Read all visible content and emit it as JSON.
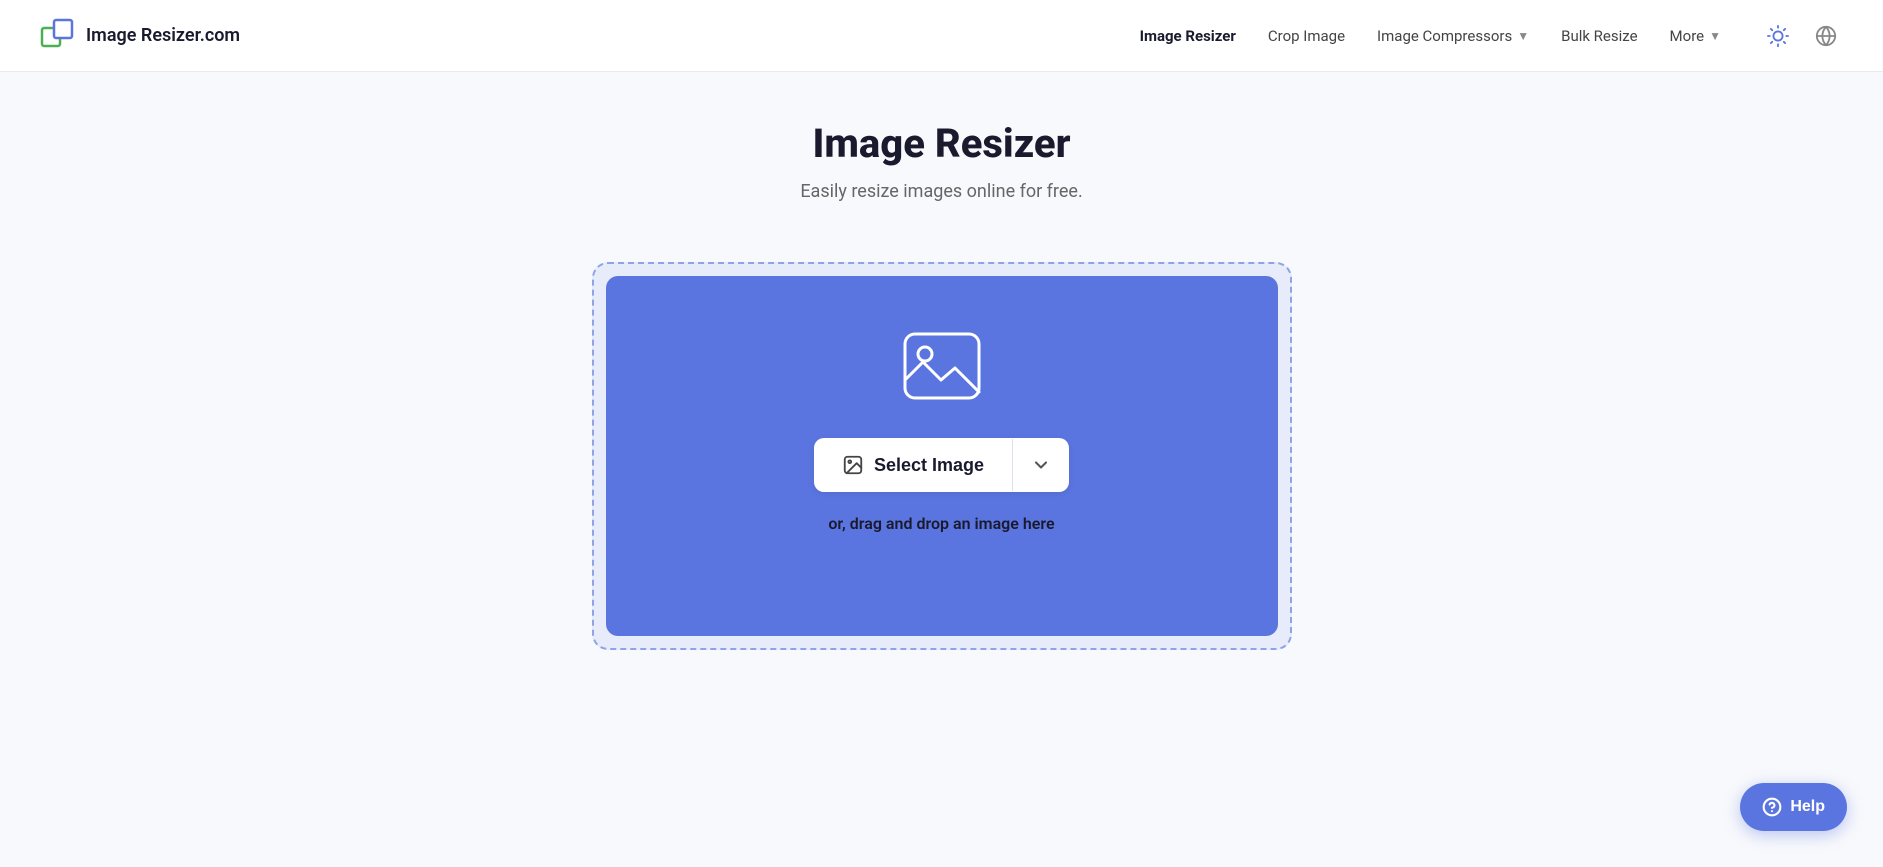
{
  "header": {
    "logo_text": "Image Resizer.com",
    "nav": {
      "items": [
        {
          "label": "Image Resizer",
          "active": true,
          "has_dropdown": false
        },
        {
          "label": "Crop Image",
          "active": false,
          "has_dropdown": false
        },
        {
          "label": "Image Compressors",
          "active": false,
          "has_dropdown": true
        },
        {
          "label": "Bulk Resize",
          "active": false,
          "has_dropdown": false
        },
        {
          "label": "More",
          "active": false,
          "has_dropdown": true
        }
      ]
    },
    "icons": {
      "theme_toggle": "☀",
      "globe": "🌐"
    }
  },
  "main": {
    "title": "Image Resizer",
    "subtitle": "Easily resize images online for free.",
    "upload": {
      "select_label": "Select Image",
      "drag_drop_text": "or, drag and drop an image here",
      "image_icon_alt": "image upload icon"
    }
  },
  "help_button": {
    "label": "Help",
    "icon": "?"
  }
}
